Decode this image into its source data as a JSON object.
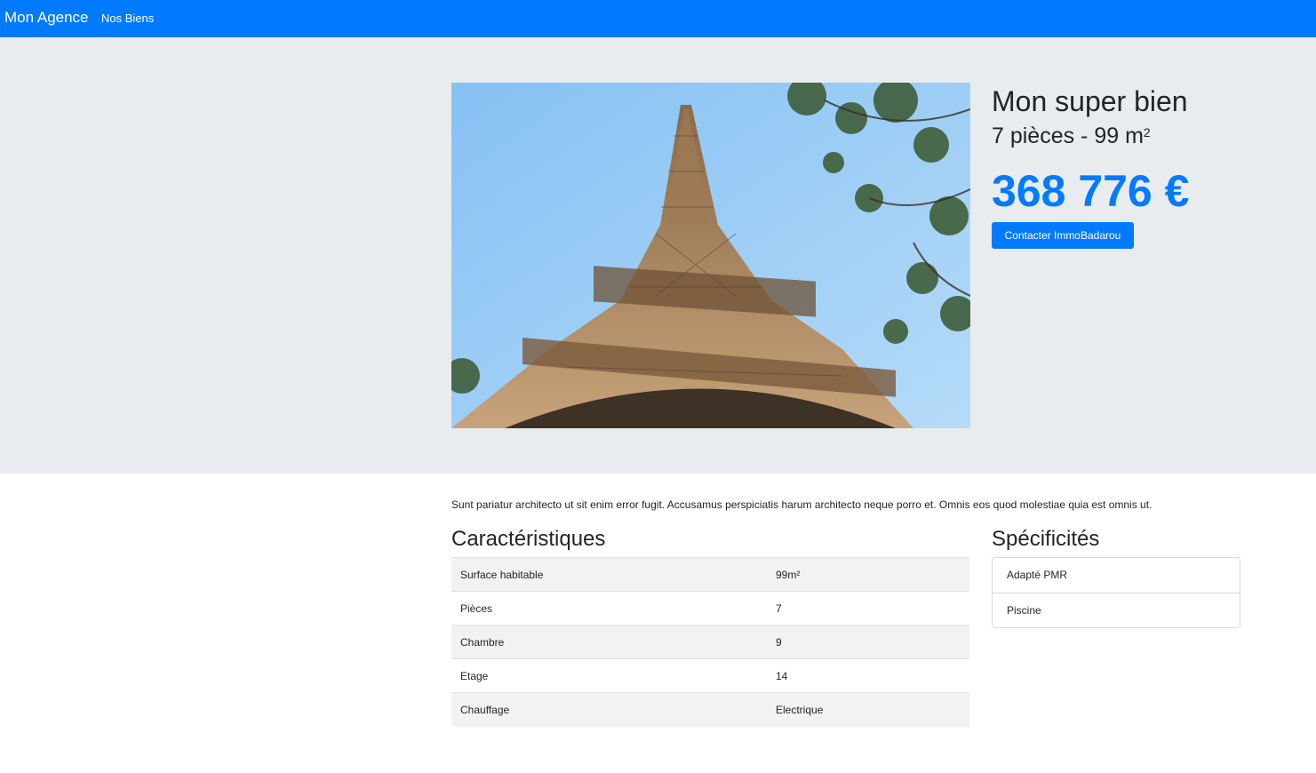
{
  "navbar": {
    "brand": "Mon Agence",
    "links": [
      "Nos Biens"
    ],
    "color": "#007bff"
  },
  "property": {
    "title": "Mon super bien",
    "rooms_area_prefix": "7 pièces - 99 m",
    "area_unit_exponent": "2",
    "price": "368 776 €",
    "contact_button": "Contacter ImmoBadarou",
    "photo_alt": "photo",
    "description": "Sunt pariatur architecto ut sit enim error fugit. Accusamus perspiciatis harum architecto neque porro et. Omnis eos quod molestiae quia est omnis ut."
  },
  "caracteristiques": {
    "heading": "Caractéristiques",
    "rows": [
      {
        "label": "Surface habitable",
        "value": "99m²"
      },
      {
        "label": "Pièces",
        "value": "7"
      },
      {
        "label": "Chambre",
        "value": "9"
      },
      {
        "label": "Etage",
        "value": "14"
      },
      {
        "label": "Chauffage",
        "value": "Electrique"
      }
    ]
  },
  "specificites": {
    "heading": "Spécificités",
    "items": [
      "Adapté PMR",
      "Piscine"
    ]
  },
  "colors": {
    "primary": "#007bff",
    "hero_bg": "#e9ecef",
    "text": "#212529",
    "stripe": "#f2f2f2"
  }
}
